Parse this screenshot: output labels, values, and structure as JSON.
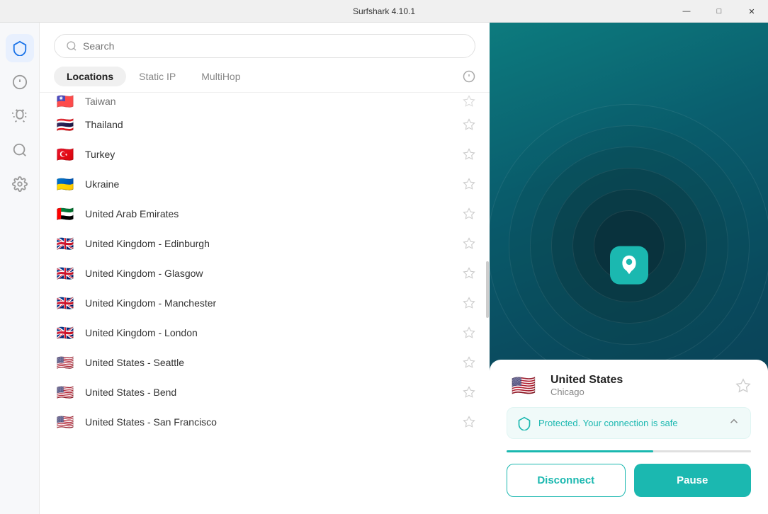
{
  "titleBar": {
    "title": "Surfshark 4.10.1",
    "controls": {
      "minimize": "—",
      "maximize": "□",
      "close": "✕"
    }
  },
  "sidebar": {
    "icons": [
      {
        "name": "shield-icon",
        "label": "Shield",
        "active": true
      },
      {
        "name": "alert-icon",
        "label": "Alert",
        "active": false
      },
      {
        "name": "bug-icon",
        "label": "Bug",
        "active": false
      },
      {
        "name": "search-icon",
        "label": "Search",
        "active": false
      },
      {
        "name": "settings-icon",
        "label": "Settings",
        "active": false
      }
    ]
  },
  "search": {
    "placeholder": "Search"
  },
  "tabs": {
    "items": [
      {
        "label": "Locations",
        "active": true
      },
      {
        "label": "Static IP",
        "active": false
      },
      {
        "label": "MultiHop",
        "active": false
      }
    ]
  },
  "locations": [
    {
      "name": "Taiwan",
      "flag": "🇹🇼",
      "favorited": false,
      "partial": true
    },
    {
      "name": "Thailand",
      "flag": "🇹🇭",
      "favorited": false,
      "partial": false
    },
    {
      "name": "Turkey",
      "flag": "🇹🇷",
      "favorited": false,
      "partial": false
    },
    {
      "name": "Ukraine",
      "flag": "🇺🇦",
      "favorited": false,
      "partial": false
    },
    {
      "name": "United Arab Emirates",
      "flag": "🇦🇪",
      "favorited": false,
      "partial": false
    },
    {
      "name": "United Kingdom - Edinburgh",
      "flag": "🇬🇧",
      "favorited": false,
      "partial": false
    },
    {
      "name": "United Kingdom - Glasgow",
      "flag": "🇬🇧",
      "favorited": false,
      "partial": false
    },
    {
      "name": "United Kingdom - Manchester",
      "flag": "🇬🇧",
      "favorited": false,
      "partial": false
    },
    {
      "name": "United Kingdom - London",
      "flag": "🇬🇧",
      "favorited": false,
      "partial": false
    },
    {
      "name": "United States - Seattle",
      "flag": "🇺🇸",
      "favorited": false,
      "partial": false
    },
    {
      "name": "United States - Bend",
      "flag": "🇺🇸",
      "favorited": false,
      "partial": false
    },
    {
      "name": "United States - San Francisco",
      "flag": "🇺🇸",
      "favorited": false,
      "partial": false
    }
  ],
  "connectedLocation": {
    "country": "United States",
    "city": "Chicago",
    "flag": "🇺🇸",
    "favorited": false
  },
  "status": {
    "text": "Protected. Your connection is safe"
  },
  "buttons": {
    "disconnect": "Disconnect",
    "pause": "Pause"
  },
  "colors": {
    "teal": "#1bb8b0",
    "darkTeal": "#0a5e6e"
  }
}
